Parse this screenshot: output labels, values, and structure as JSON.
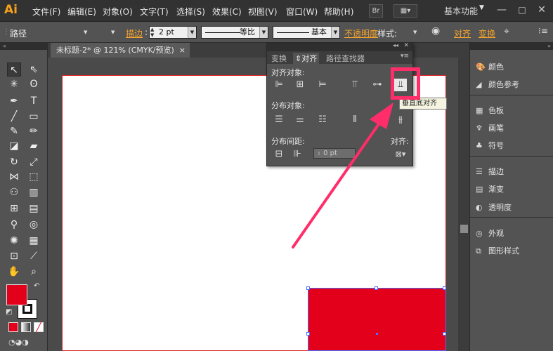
{
  "app": {
    "logo": "Ai"
  },
  "menu": [
    "文件(F)",
    "编辑(E)",
    "对象(O)",
    "文字(T)",
    "选择(S)",
    "效果(C)",
    "视图(V)",
    "窗口(W)",
    "帮助(H)"
  ],
  "menubar": {
    "br_label": "Br",
    "workspace": "基本功能"
  },
  "control": {
    "selection_type": "路径",
    "stroke_label": "描边",
    "stroke_weight": "2 pt",
    "profile_label": "等比",
    "brush_label": "基本",
    "opacity_label": "不透明度",
    "style_label": "样式:",
    "align_label": "对齐",
    "transform_label": "变换"
  },
  "document": {
    "tab_title": "未标题-2* @ 121% (CMYK/预览)",
    "close": "×"
  },
  "align_panel": {
    "tabs": [
      "变换",
      "对齐",
      "路径查找器"
    ],
    "align_objects": "对齐对象:",
    "distribute_objects": "分布对象:",
    "distribute_spacing": "分布间距:",
    "align_to": "对齐:",
    "spacing_value": "0 pt",
    "tooltip": "垂直底对齐"
  },
  "right_panel": {
    "group1": [
      "颜色",
      "颜色参考"
    ],
    "group2": [
      "色板",
      "画笔",
      "符号"
    ],
    "group3": [
      "描边",
      "渐变",
      "透明度"
    ],
    "group4": [
      "外观",
      "图形样式"
    ]
  },
  "colors": {
    "fill": "#e3001b",
    "highlight": "#ff2d6a",
    "accent": "#f4a32c"
  }
}
